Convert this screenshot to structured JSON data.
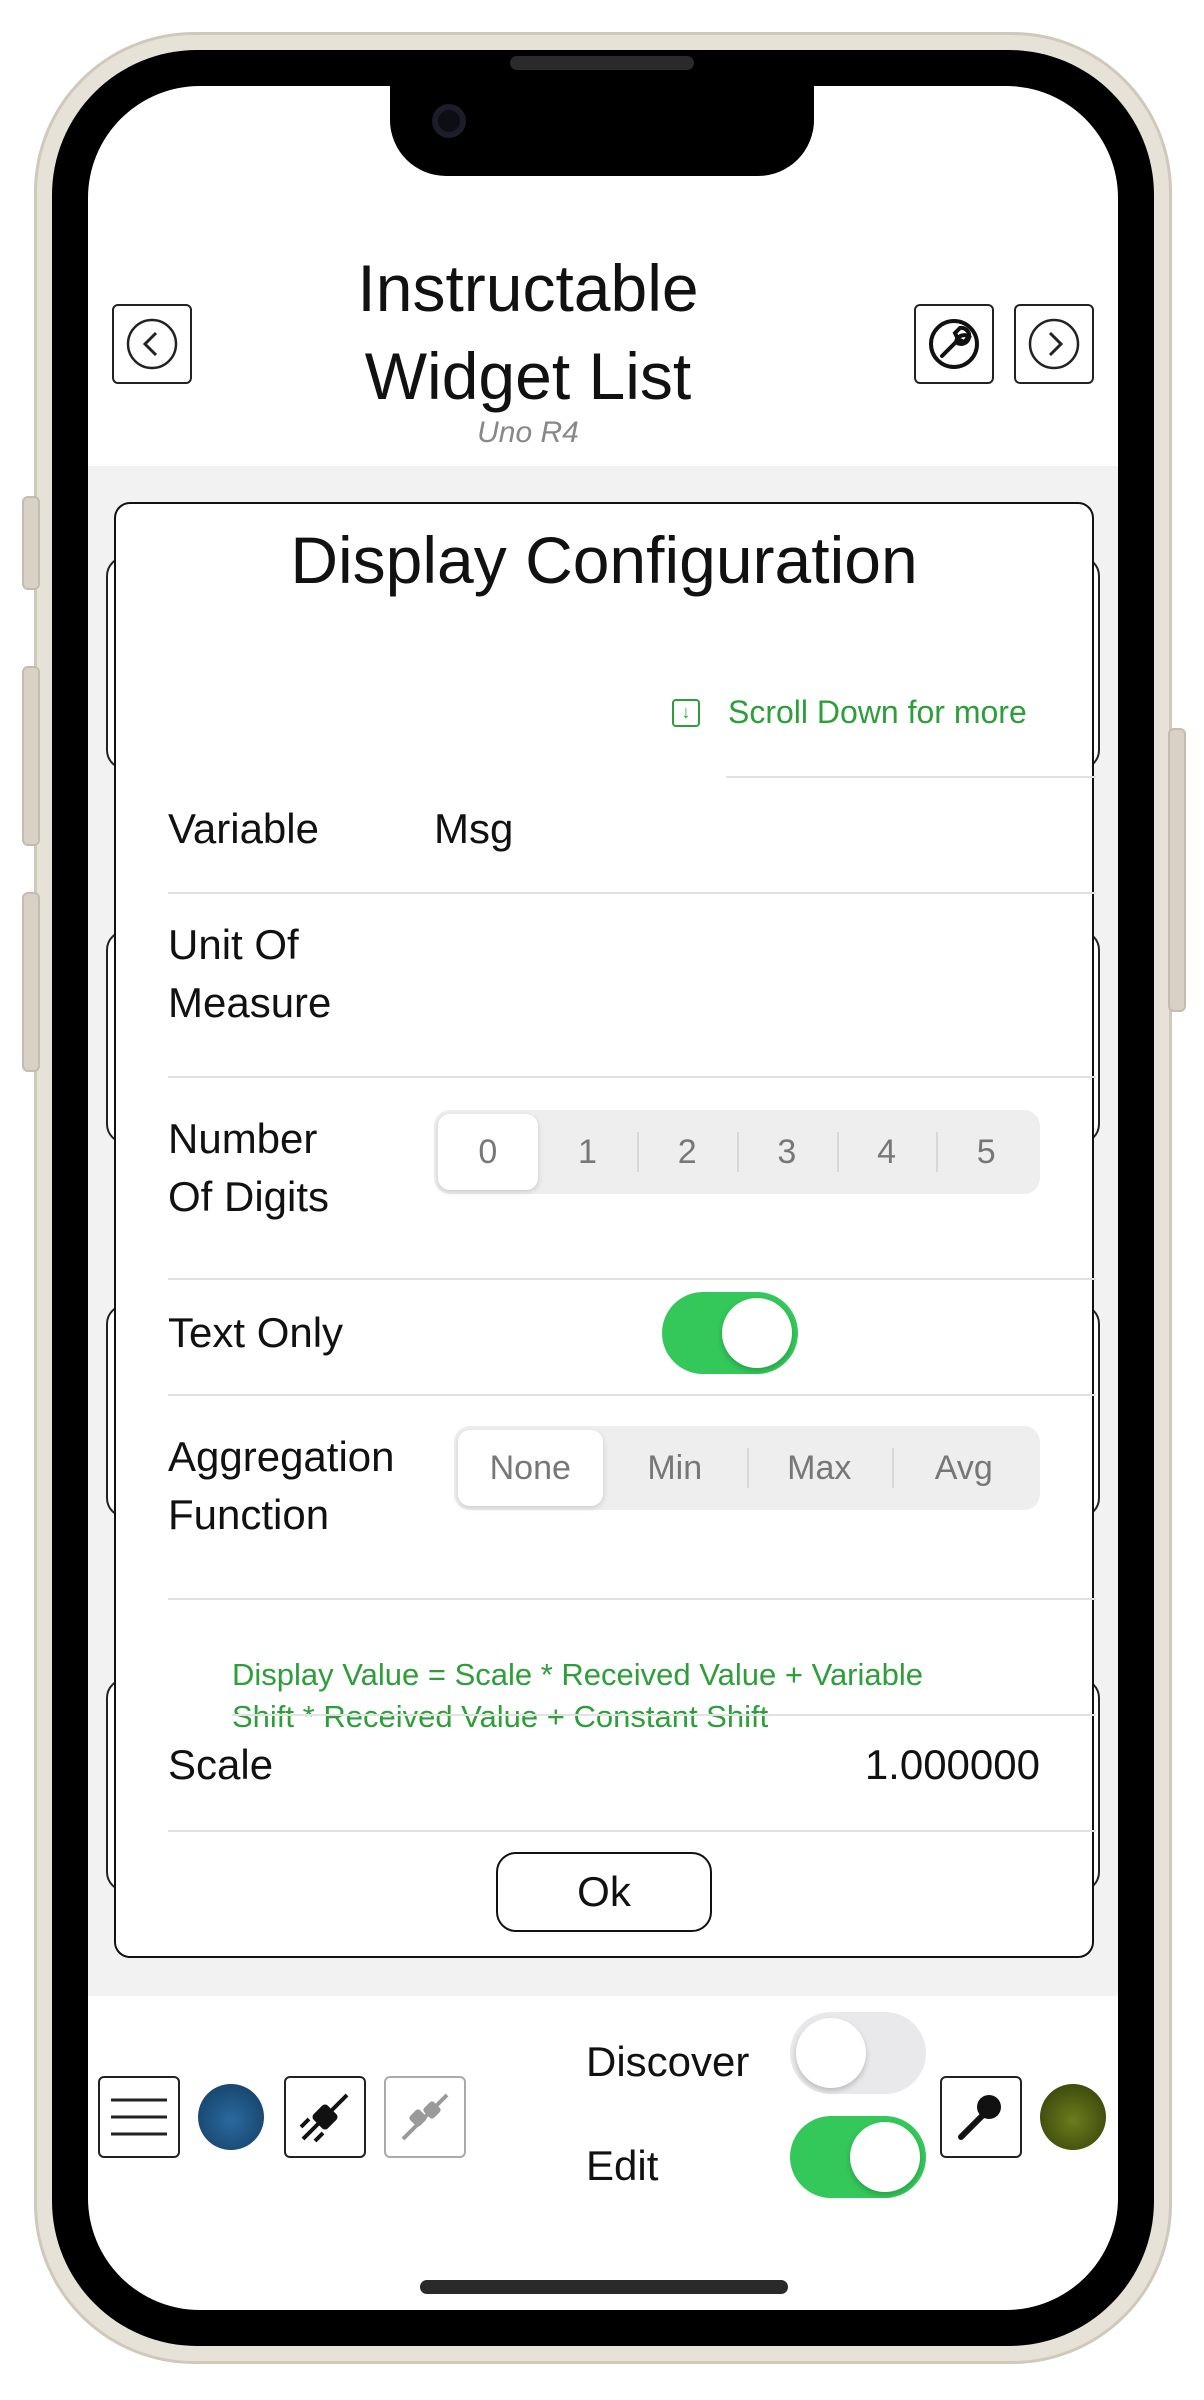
{
  "header": {
    "title_line1": "Instructable",
    "title_line2": "Widget List",
    "subtitle": "Uno R4"
  },
  "dialog": {
    "title": "Display Configuration",
    "scroll_hint": "Scroll Down for more",
    "variable": {
      "label": "Variable",
      "value": "Msg"
    },
    "unit_of_measure": {
      "label_line1": "Unit Of",
      "label_line2": "Measure",
      "value": ""
    },
    "number_of_digits": {
      "label_line1": "Number",
      "label_line2": "Of Digits",
      "options": [
        "0",
        "1",
        "2",
        "3",
        "4",
        "5"
      ],
      "selected": "0"
    },
    "text_only": {
      "label": "Text Only",
      "on": true
    },
    "aggregation": {
      "label_line1": "Aggregation",
      "label_line2": "Function",
      "options": [
        "None",
        "Min",
        "Max",
        "Avg"
      ],
      "selected": "None"
    },
    "formula_line1": "Display Value = Scale * Received Value + Variable",
    "formula_line2": "Shift * Received Value + Constant Shift",
    "scale": {
      "label": "Scale",
      "value": "1.000000"
    },
    "ok_label": "Ok"
  },
  "toolbar": {
    "discover_label": "Discover",
    "discover_on": false,
    "edit_label": "Edit",
    "edit_on": true
  },
  "colors": {
    "accent_green": "#2e9e3a",
    "toggle_on": "#34c759",
    "status_blue": "#1f4f7a",
    "status_olive": "#4a5a10"
  },
  "icons": {
    "back": "chevron-left-icon",
    "forward": "chevron-right-icon",
    "settings": "wrench-icon",
    "menu": "hamburger-menu-icon",
    "connect": "plug-icon",
    "disconnect": "plug-disabled-icon",
    "mic": "microphone-icon",
    "scroll": "arrow-down-box-icon"
  }
}
